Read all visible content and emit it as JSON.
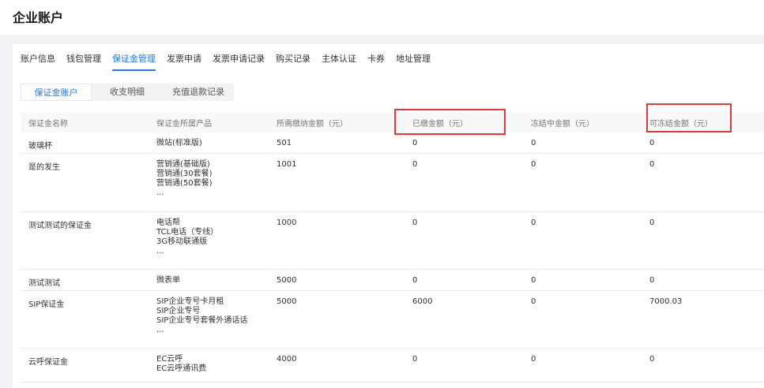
{
  "header": {
    "title": "企业账户"
  },
  "tabs": [
    {
      "label": "账户信息"
    },
    {
      "label": "钱包管理"
    },
    {
      "label": "保证金管理"
    },
    {
      "label": "发票申请"
    },
    {
      "label": "发票申请记录"
    },
    {
      "label": "购买记录"
    },
    {
      "label": "主体认证"
    },
    {
      "label": "卡券"
    },
    {
      "label": "地址管理"
    }
  ],
  "subtabs": [
    {
      "label": "保证金账户"
    },
    {
      "label": "收支明细"
    },
    {
      "label": "充值退款记录"
    }
  ],
  "table": {
    "headers": [
      "保证金名称",
      "保证金所属产品",
      "所需缴纳金额（元）",
      "已缴金额（元）",
      "冻结中金额（元）",
      "可冻结金额（元）"
    ],
    "rows": [
      {
        "name": "玻璃杯",
        "products": [
          "微站(标准版)"
        ],
        "required": "501",
        "paid": "0",
        "frozen": "0",
        "freezable": "0"
      },
      {
        "name": "是的发生",
        "products": [
          "营销通(基础版)",
          "营销通(30套餐)",
          "营销通(50套餐)",
          "..."
        ],
        "required": "1001",
        "paid": "0",
        "frozen": "0",
        "freezable": "0"
      },
      {
        "name": "测试测试的保证金",
        "products": [
          "电话帮",
          "TCL电话（专线）",
          "3G移动联通版",
          "..."
        ],
        "required": "1000",
        "paid": "0",
        "frozen": "0",
        "freezable": "0"
      },
      {
        "name": "测试测试",
        "products": [
          "微表单"
        ],
        "required": "5000",
        "paid": "0",
        "frozen": "0",
        "freezable": "0"
      },
      {
        "name": "SIP保证金",
        "products": [
          "SIP企业专号卡月租",
          "SIP企业专号",
          "SIP企业专号套餐外通话话",
          "..."
        ],
        "required": "5000",
        "paid": "6000",
        "frozen": "0",
        "freezable": "7000.03"
      },
      {
        "name": "云呼保证金",
        "products": [
          "EC云呼",
          "EC云呼通讯费"
        ],
        "required": "4000",
        "paid": "0",
        "frozen": "0",
        "freezable": "0"
      }
    ]
  }
}
